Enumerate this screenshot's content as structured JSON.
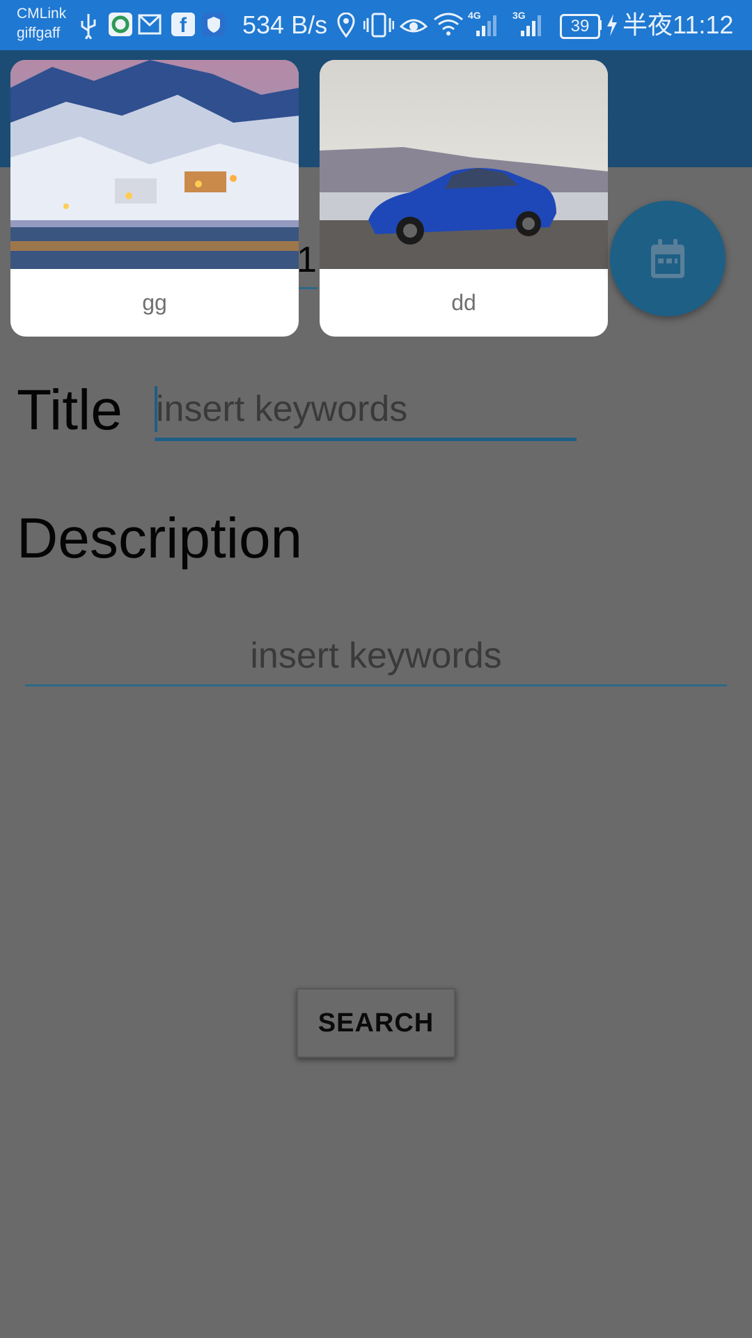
{
  "status_bar": {
    "carrier_line1": "CMLink",
    "carrier_line2": "giffgaff",
    "net_speed": "534 B/s",
    "network_4g": "4G",
    "network_3g": "3G",
    "battery": "39",
    "time": "半夜11:12",
    "icons": [
      "usb-icon",
      "app-icon",
      "mail-icon",
      "facebook-icon",
      "shield-icon",
      "location-icon",
      "vibrate-icon",
      "eye-icon",
      "wifi-icon",
      "signal-icon",
      "charging-icon"
    ]
  },
  "cards": [
    {
      "label": "gg",
      "image": "snowy-village-photo"
    },
    {
      "label": "dd",
      "image": "blue-car-photo"
    }
  ],
  "peek_text": "1",
  "fab": {
    "icon": "calendar-icon"
  },
  "form": {
    "title_label": "Title",
    "title_placeholder": "insert keywords",
    "description_label": "Description",
    "description_placeholder": "insert keywords"
  },
  "search_button": "SEARCH",
  "colors": {
    "status_bar": "#1f78d1",
    "app_bar": "#1c4c74",
    "accent": "#1e5f85",
    "scrim_background": "#6a6a6a",
    "card": "#ffffff"
  }
}
